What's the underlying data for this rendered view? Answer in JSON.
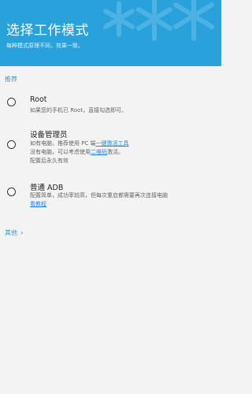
{
  "header": {
    "title": "选择工作模式",
    "subtitle": "每种模式原理不同，效果一致。"
  },
  "section": {
    "recommended": "推荐"
  },
  "options": [
    {
      "title": "Root",
      "lines": [
        "如果您的手机已 Root，直接勾选即可。"
      ]
    },
    {
      "title": "设备管理员",
      "line1_prefix": "如有电脑，推荐使用 PC 端",
      "line1_link": "一键激活工具",
      "line2_prefix": "没有电脑，可以考虑使用",
      "line2_link": "二维码",
      "line2_suffix": "激活。",
      "line3": "配置后永久有效"
    },
    {
      "title": "普通 ADB",
      "line1": "配置简单，成功率较高，但每次重启都需要再次连接电脑",
      "line2_link": "看教程"
    }
  ],
  "other": {
    "label": "其他",
    "chevron": "›"
  },
  "colors": {
    "header": "#29a2dc",
    "accent": "#2a9fd8",
    "link": "#1e88e5"
  }
}
